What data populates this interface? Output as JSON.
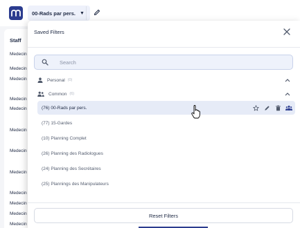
{
  "colors": {
    "brand": "#2b3c8f",
    "selected_row": "#e6ebf7",
    "search_bg": "#eef2fb"
  },
  "header": {
    "logo_icon": "brand-m-logo",
    "view_select_label": "00-Rads par pers.",
    "view_select_icon": "caret-down-icon",
    "edit_icon": "pencil-icon"
  },
  "background_table": {
    "column_header": "Staff",
    "rows": [
      "Medecin",
      "Medecin",
      "Medecin",
      "Medecin",
      "Medecin",
      "Medecin",
      "Medecin",
      "Medecin",
      "Medecin",
      "Medecin",
      "Medecin",
      "Medecin",
      "Medecin"
    ]
  },
  "modal": {
    "title": "Saved Filters",
    "close_icon": "close-icon",
    "search": {
      "placeholder": "Search",
      "icon": "search-icon"
    },
    "groups": {
      "personal": {
        "label": "Personal",
        "count": "(0)",
        "icon": "person-icon"
      },
      "common": {
        "label": "Common",
        "count": "(6)",
        "icon": "people-icon"
      }
    },
    "items": [
      {
        "label": "(76) 00-Rads par pers.",
        "selected": true
      },
      {
        "label": "(77) 15-Gardes",
        "selected": false
      },
      {
        "label": "(10) Planning Complet",
        "selected": false
      },
      {
        "label": "(26) Planning des Radiologues",
        "selected": false
      },
      {
        "label": "(24) Planning des Secrétaires",
        "selected": false
      },
      {
        "label": "(25) Plannings des Manipulateurs",
        "selected": false
      }
    ],
    "item_action_icons": [
      "star-icon",
      "pencil-icon",
      "trash-icon",
      "share-users-icon"
    ],
    "reset_label": "Reset Filters"
  }
}
